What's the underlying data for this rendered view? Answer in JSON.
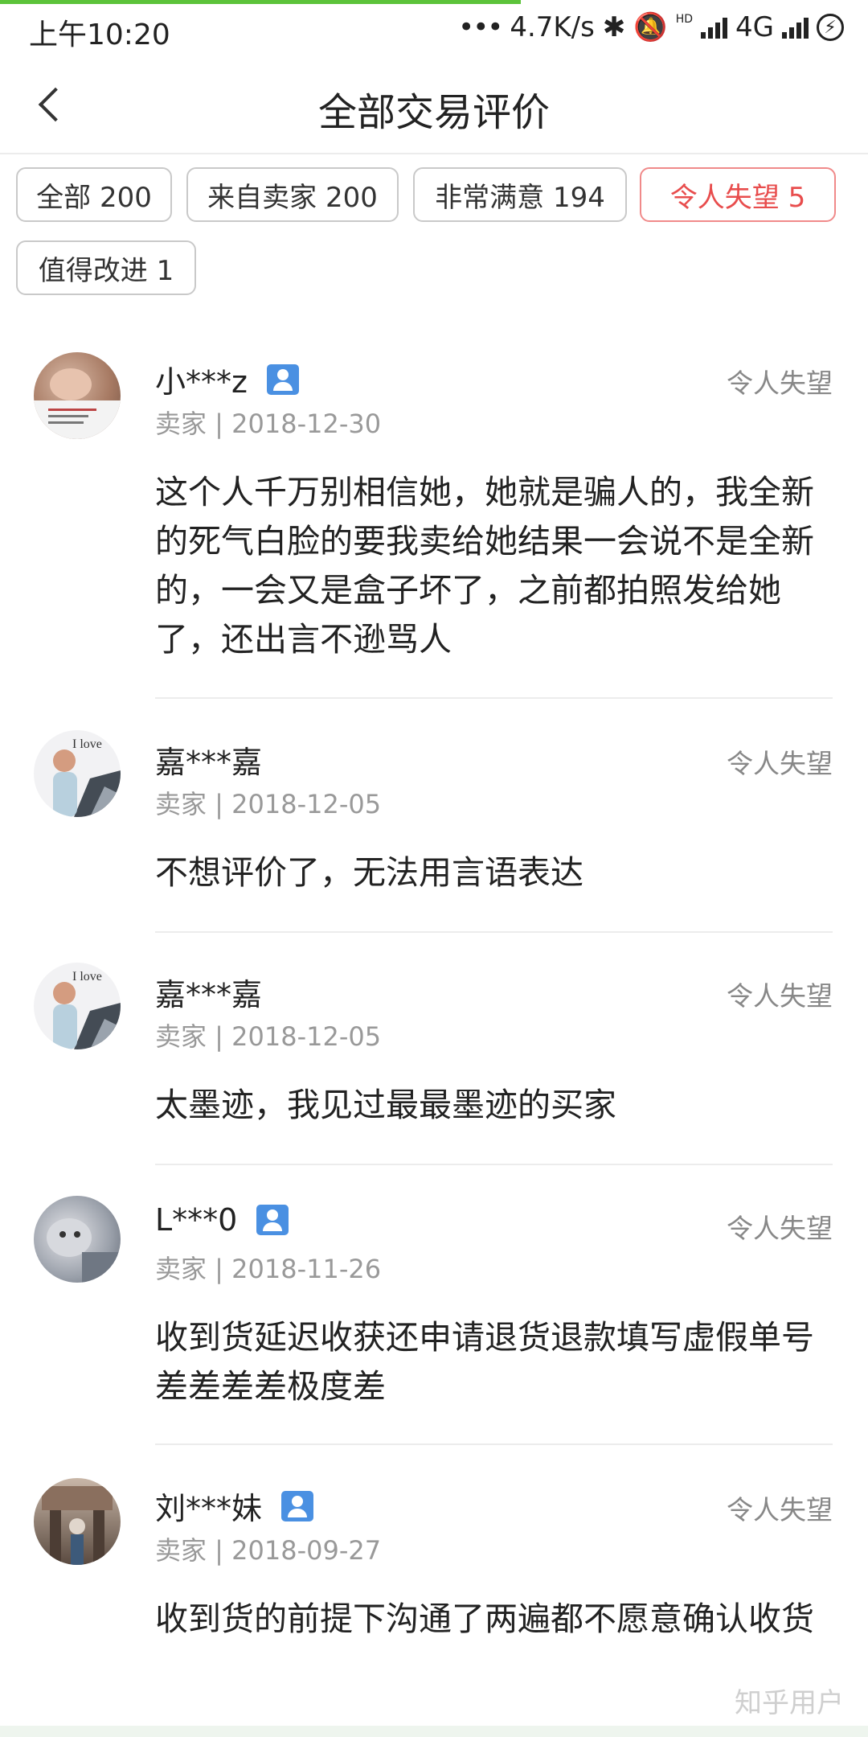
{
  "status": {
    "time": "上午10:20",
    "dots": "•••",
    "speed": "4.7K/s",
    "network": "4G",
    "hd": "HD"
  },
  "header": {
    "title": "全部交易评价",
    "back_icon": "chevron-left-icon"
  },
  "filters": [
    {
      "label": "全部 200",
      "active": false
    },
    {
      "label": "来自卖家 200",
      "active": false
    },
    {
      "label": "非常满意 194",
      "active": false
    },
    {
      "label": "令人失望 5",
      "active": true
    },
    {
      "label": "值得改进 1",
      "active": false
    }
  ],
  "reviews": [
    {
      "name": "小***z",
      "verified": true,
      "tag": "令人失望",
      "meta": "卖家 | 2018-12-30",
      "text": "这个人千万别相信她，她就是骗人的，我全新的死气白脸的要我卖给她结果一会说不是全新的，一会又是盒子坏了，之前都拍照发给她了，还出言不逊骂人"
    },
    {
      "name": "嘉***嘉",
      "verified": false,
      "tag": "令人失望",
      "meta": "卖家 | 2018-12-05",
      "text": "不想评价了，无法用言语表达"
    },
    {
      "name": "嘉***嘉",
      "verified": false,
      "tag": "令人失望",
      "meta": "卖家 | 2018-12-05",
      "text": "太墨迹，我见过最最墨迹的买家"
    },
    {
      "name": "L***0",
      "verified": true,
      "tag": "令人失望",
      "meta": "卖家 | 2018-11-26",
      "text": "收到货延迟收获还申请退货退款填写虚假单号差差差差极度差"
    },
    {
      "name": "刘***妹",
      "verified": true,
      "tag": "令人失望",
      "meta": "卖家 | 2018-09-27",
      "text": "收到货的前提下沟通了两遍都不愿意确认收货"
    }
  ],
  "avatar_text": {
    "love": "I love"
  },
  "watermark": "知乎用户",
  "colors": {
    "accent_red": "#e84d4d",
    "verify_blue": "#4a90e2",
    "progress_green": "#5cc33a"
  }
}
